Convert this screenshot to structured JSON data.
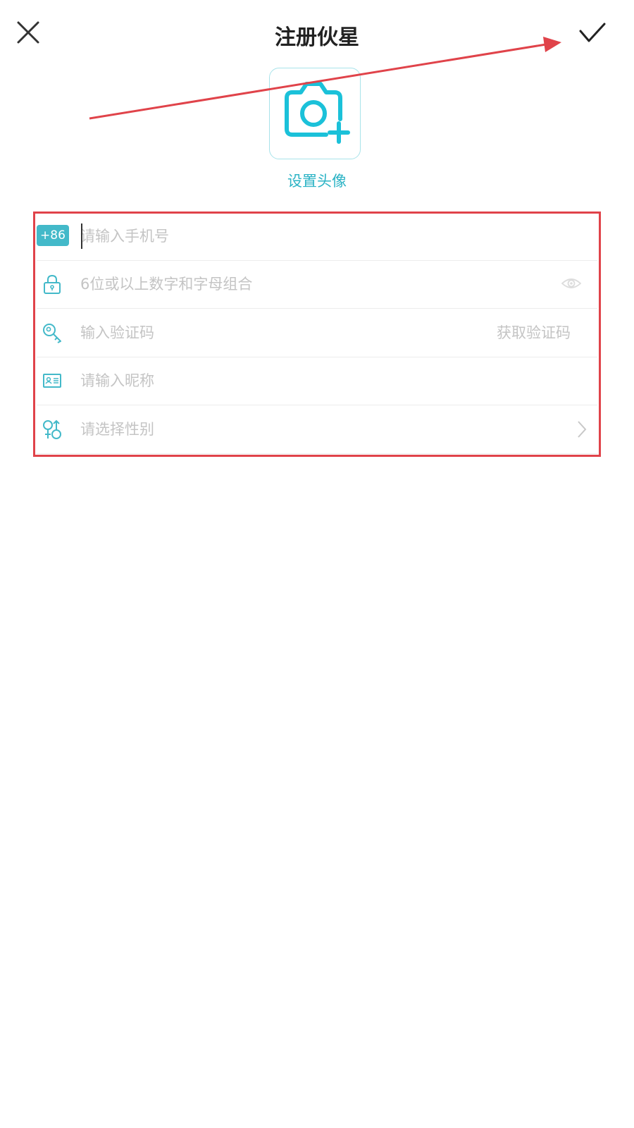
{
  "header": {
    "title": "注册伙星"
  },
  "avatar": {
    "label": "设置头像"
  },
  "form": {
    "phone": {
      "country_code": "+86",
      "placeholder": "请输入手机号"
    },
    "password": {
      "placeholder": "6位或以上数字和字母组合"
    },
    "code": {
      "placeholder": "输入验证码",
      "get_code_label": "获取验证码"
    },
    "nickname": {
      "placeholder": "请输入昵称"
    },
    "gender": {
      "placeholder": "请选择性别"
    }
  },
  "colors": {
    "accent": "#43b9c9",
    "annotation": "#e0434a",
    "placeholder": "#c4c4c4"
  }
}
